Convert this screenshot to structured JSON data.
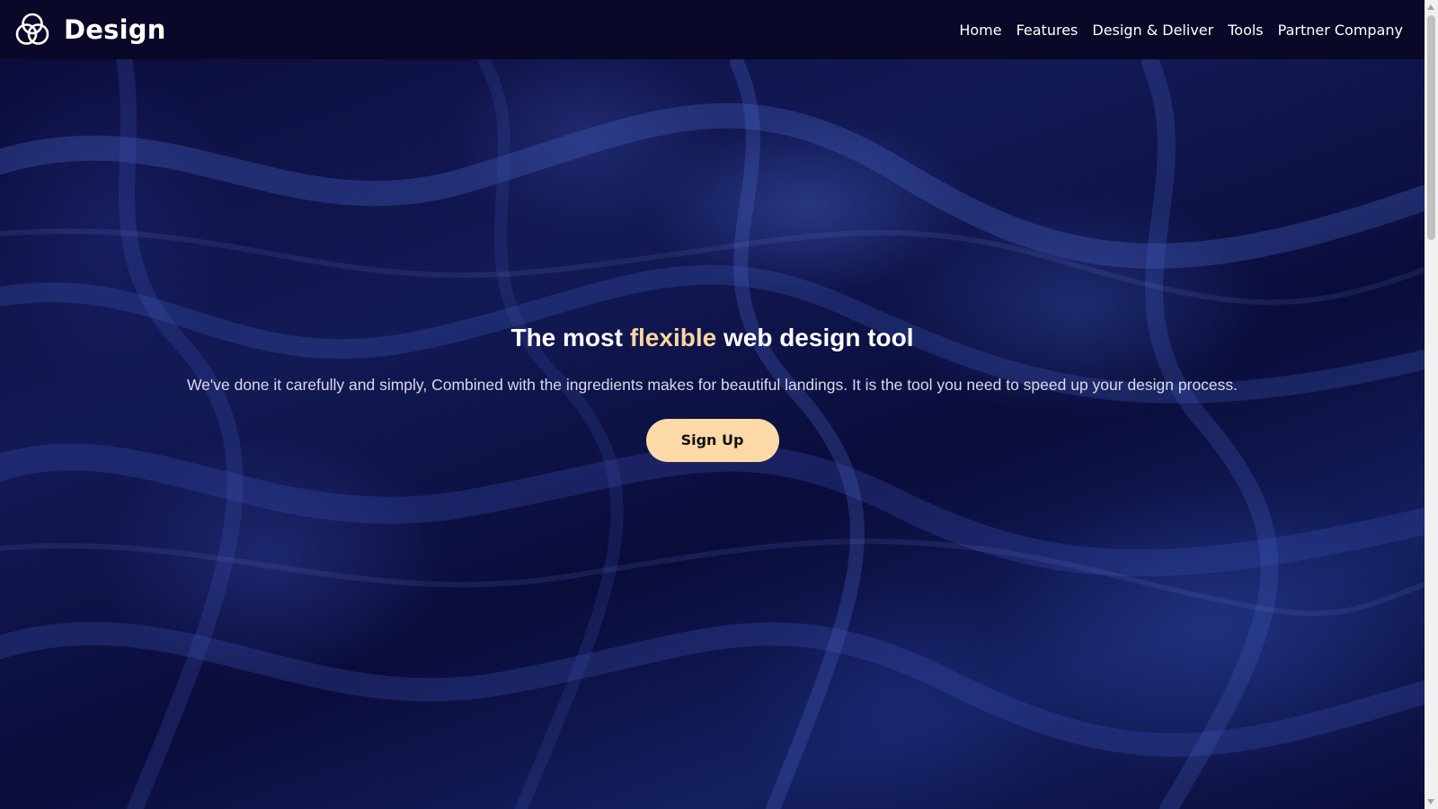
{
  "brand": {
    "name": "Design",
    "logo_icon": "three-circles-logo-icon"
  },
  "nav": {
    "items": [
      {
        "label": "Home"
      },
      {
        "label": "Features"
      },
      {
        "label": "Design & Deliver"
      },
      {
        "label": "Tools"
      },
      {
        "label": "Partner Company"
      }
    ]
  },
  "hero": {
    "headline_before": "The most ",
    "headline_accent": "flexible",
    "headline_after": " web design tool",
    "subtitle": "We've done it carefully and simply, Combined with the ingredients makes for beautiful landings. It is the tool you need to speed up your design process.",
    "cta_label": "Sign Up",
    "background": "dark blue marble swirl"
  },
  "colors": {
    "navbar": "#0a0828",
    "accent": "#fdd5a0",
    "cta_background": "#fdd9a8",
    "hero_base": "#0b0b3a"
  }
}
